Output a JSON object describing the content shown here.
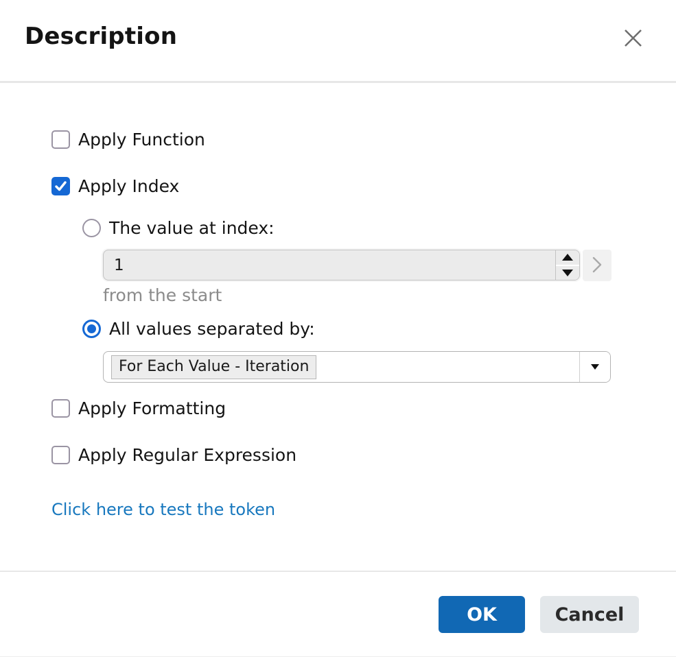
{
  "dialog": {
    "title": "Description"
  },
  "form": {
    "apply_function": {
      "label": "Apply Function",
      "checked": false
    },
    "apply_index": {
      "label": "Apply Index",
      "checked": true
    },
    "value_at_index": {
      "label": "The value at index:",
      "selected": false
    },
    "index_input": {
      "value": "1"
    },
    "index_hint": "from the start",
    "all_values": {
      "label": "All values separated by:",
      "selected": true
    },
    "separator_input": {
      "token": "For Each Value - Iteration"
    },
    "apply_formatting": {
      "label": "Apply Formatting",
      "checked": false
    },
    "apply_regular_expression": {
      "label": "Apply Regular Expression",
      "checked": false
    },
    "test_link": "Click here to test the token"
  },
  "footer": {
    "ok_label": "OK",
    "cancel_label": "Cancel"
  },
  "colors": {
    "accent_blue": "#1568d4",
    "ok_blue": "#1168b4",
    "link_blue": "#1878be",
    "divider": "#e7e7e7"
  }
}
